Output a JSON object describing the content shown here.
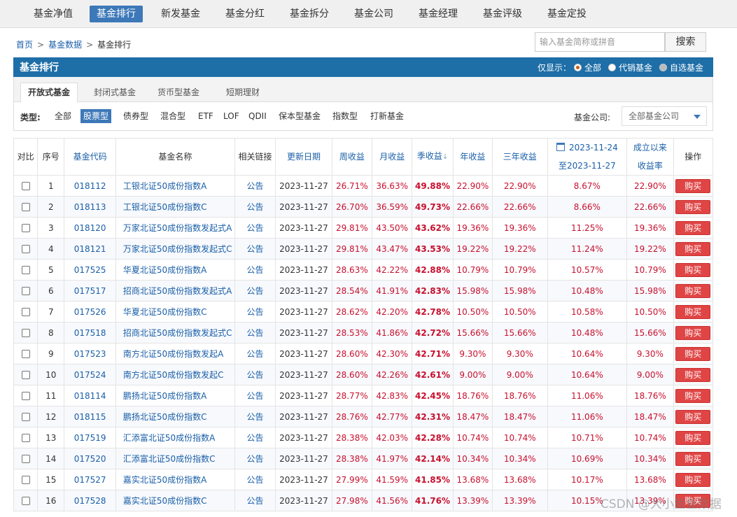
{
  "nav": [
    "基金净值",
    "基金排行",
    "新发基金",
    "基金分红",
    "基金拆分",
    "基金公司",
    "基金经理",
    "基金评级",
    "基金定投"
  ],
  "breadcrumb": {
    "home": "首页",
    "sep1": ">",
    "data": "基金数据",
    "sep2": ">",
    "current": "基金排行"
  },
  "search": {
    "placeholder": "输入基金简称或拼音",
    "button": "搜索"
  },
  "panel": {
    "title": "基金排行",
    "show_label": "仅显示：",
    "show_options": [
      "全部",
      "代销基金",
      "自选基金"
    ]
  },
  "fund_tabs": [
    "开放式基金",
    "封闭式基金",
    "货币型基金",
    "短期理财"
  ],
  "type_filter": {
    "label": "类型:",
    "options": [
      "全部",
      "股票型",
      "债券型",
      "混合型",
      "ETF",
      "LOF",
      "QDII",
      "保本型基金",
      "指数型",
      "打新基金"
    ]
  },
  "company": {
    "label": "基金公司:",
    "value": "全部基金公司"
  },
  "table": {
    "headers": {
      "compare": "对比",
      "seq": "序号",
      "code": "基金代码",
      "name": "基金名称",
      "links": "相关链接",
      "date": "更新日期",
      "week": "周收益",
      "month": "月收益",
      "quarter": "季收益",
      "sort_arrow": "↓",
      "year": "年收益",
      "three_year": "三年收益",
      "range_start": "2023-11-24",
      "range_end": "至2023-11-27",
      "since_inception_1": "成立以来",
      "since_inception_2": "收益率",
      "action": "操作"
    },
    "rows": [
      {
        "seq": "1",
        "code": "018112",
        "name": "工银北证50成份指数A",
        "link": "公告",
        "date": "2023-11-27",
        "week": "26.71%",
        "month": "36.63%",
        "quarter": "49.88%",
        "year": "22.90%",
        "three_year": "22.90%",
        "range": "8.67%",
        "since": "22.90%",
        "buy": "购买"
      },
      {
        "seq": "2",
        "code": "018113",
        "name": "工银北证50成份指数C",
        "link": "公告",
        "date": "2023-11-27",
        "week": "26.70%",
        "month": "36.59%",
        "quarter": "49.73%",
        "year": "22.66%",
        "three_year": "22.66%",
        "range": "8.66%",
        "since": "22.66%",
        "buy": "购买"
      },
      {
        "seq": "3",
        "code": "018120",
        "name": "万家北证50成份指数发起式A",
        "link": "公告",
        "date": "2023-11-27",
        "week": "29.81%",
        "month": "43.50%",
        "quarter": "43.62%",
        "year": "19.36%",
        "three_year": "19.36%",
        "range": "11.25%",
        "since": "19.36%",
        "buy": "购买"
      },
      {
        "seq": "4",
        "code": "018121",
        "name": "万家北证50成份指数发起式C",
        "link": "公告",
        "date": "2023-11-27",
        "week": "29.81%",
        "month": "43.47%",
        "quarter": "43.53%",
        "year": "19.22%",
        "three_year": "19.22%",
        "range": "11.24%",
        "since": "19.22%",
        "buy": "购买"
      },
      {
        "seq": "5",
        "code": "017525",
        "name": "华夏北证50成份指数A",
        "link": "公告",
        "date": "2023-11-27",
        "week": "28.63%",
        "month": "42.22%",
        "quarter": "42.88%",
        "year": "10.79%",
        "three_year": "10.79%",
        "range": "10.57%",
        "since": "10.79%",
        "buy": "购买"
      },
      {
        "seq": "6",
        "code": "017517",
        "name": "招商北证50成份指数发起式A",
        "link": "公告",
        "date": "2023-11-27",
        "week": "28.54%",
        "month": "41.91%",
        "quarter": "42.83%",
        "year": "15.98%",
        "three_year": "15.98%",
        "range": "10.48%",
        "since": "15.98%",
        "buy": "购买"
      },
      {
        "seq": "7",
        "code": "017526",
        "name": "华夏北证50成份指数C",
        "link": "公告",
        "date": "2023-11-27",
        "week": "28.62%",
        "month": "42.20%",
        "quarter": "42.78%",
        "year": "10.50%",
        "three_year": "10.50%",
        "range": "10.58%",
        "since": "10.50%",
        "buy": "购买"
      },
      {
        "seq": "8",
        "code": "017518",
        "name": "招商北证50成份指数发起式C",
        "link": "公告",
        "date": "2023-11-27",
        "week": "28.53%",
        "month": "41.86%",
        "quarter": "42.72%",
        "year": "15.66%",
        "three_year": "15.66%",
        "range": "10.48%",
        "since": "15.66%",
        "buy": "购买"
      },
      {
        "seq": "9",
        "code": "017523",
        "name": "南方北证50成份指数发起A",
        "link": "公告",
        "date": "2023-11-27",
        "week": "28.60%",
        "month": "42.30%",
        "quarter": "42.71%",
        "year": "9.30%",
        "three_year": "9.30%",
        "range": "10.64%",
        "since": "9.30%",
        "buy": "购买"
      },
      {
        "seq": "10",
        "code": "017524",
        "name": "南方北证50成份指数发起C",
        "link": "公告",
        "date": "2023-11-27",
        "week": "28.60%",
        "month": "42.26%",
        "quarter": "42.61%",
        "year": "9.00%",
        "three_year": "9.00%",
        "range": "10.64%",
        "since": "9.00%",
        "buy": "购买"
      },
      {
        "seq": "11",
        "code": "018114",
        "name": "鹏扬北证50成份指数A",
        "link": "公告",
        "date": "2023-11-27",
        "week": "28.77%",
        "month": "42.83%",
        "quarter": "42.45%",
        "year": "18.76%",
        "three_year": "18.76%",
        "range": "11.06%",
        "since": "18.76%",
        "buy": "购买"
      },
      {
        "seq": "12",
        "code": "018115",
        "name": "鹏扬北证50成份指数C",
        "link": "公告",
        "date": "2023-11-27",
        "week": "28.76%",
        "month": "42.77%",
        "quarter": "42.31%",
        "year": "18.47%",
        "three_year": "18.47%",
        "range": "11.06%",
        "since": "18.47%",
        "buy": "购买"
      },
      {
        "seq": "13",
        "code": "017519",
        "name": "汇添富北证50成份指数A",
        "link": "公告",
        "date": "2023-11-27",
        "week": "28.38%",
        "month": "42.03%",
        "quarter": "42.28%",
        "year": "10.74%",
        "three_year": "10.74%",
        "range": "10.71%",
        "since": "10.74%",
        "buy": "购买"
      },
      {
        "seq": "14",
        "code": "017520",
        "name": "汇添富北证50成份指数C",
        "link": "公告",
        "date": "2023-11-27",
        "week": "28.38%",
        "month": "41.97%",
        "quarter": "42.14%",
        "year": "10.34%",
        "three_year": "10.34%",
        "range": "10.69%",
        "since": "10.34%",
        "buy": "购买"
      },
      {
        "seq": "15",
        "code": "017527",
        "name": "嘉实北证50成份指数A",
        "link": "公告",
        "date": "2023-11-27",
        "week": "27.99%",
        "month": "41.59%",
        "quarter": "41.85%",
        "year": "13.68%",
        "three_year": "13.68%",
        "range": "10.17%",
        "since": "13.68%",
        "buy": "购买"
      },
      {
        "seq": "16",
        "code": "017528",
        "name": "嘉实北证50成份指数C",
        "link": "公告",
        "date": "2023-11-27",
        "week": "27.98%",
        "month": "41.56%",
        "quarter": "41.76%",
        "year": "13.39%",
        "three_year": "13.39%",
        "range": "10.15%",
        "since": "13.39%",
        "buy": "购买"
      }
    ]
  },
  "watermark": "CSDN @大小鱼鱼数据",
  "colors": {
    "nav_active": "#3d78b8",
    "header_bg": "#1e6ea7",
    "link": "#1a5fa8",
    "gain": "#c8102e",
    "buy_button": "#e04545"
  }
}
